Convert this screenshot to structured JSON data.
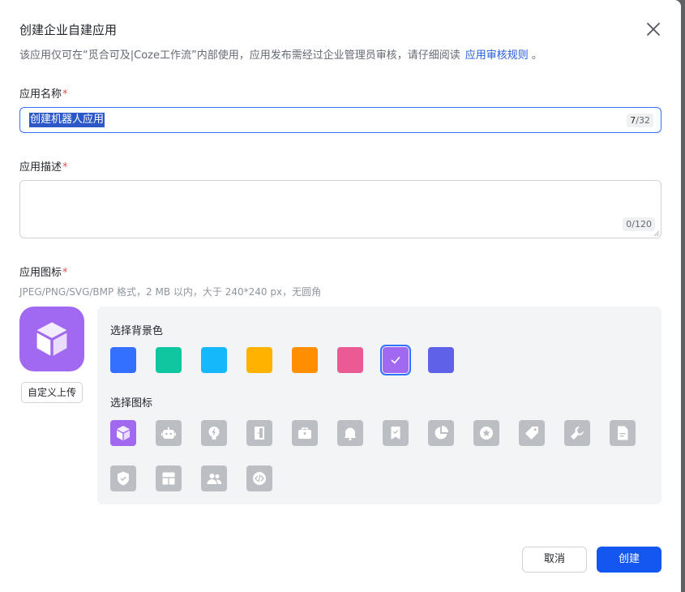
{
  "dialog": {
    "title": "创建企业自建应用",
    "subtitle": "该应用仅可在“觅合可及|Coze工作流”内部使用，应用发布需经过企业管理员审核，请仔细阅读",
    "rules_link": "应用审核规则",
    "subtitle_end": "。"
  },
  "name_field": {
    "label": "应用名称",
    "required_mark": "*",
    "value": "创建机器人应用",
    "count": "7",
    "max": "/32"
  },
  "desc_field": {
    "label": "应用描述",
    "required_mark": "*",
    "value": "",
    "counter": "0/120"
  },
  "icon_field": {
    "label": "应用图标",
    "required_mark": "*",
    "hint": "JPEG/PNG/SVG/BMP 格式，2 MB 以内，大于 240*240 px，无圆角",
    "upload_label": "自定义上传",
    "bg_title": "选择背景色",
    "icon_title": "选择图标",
    "colors": [
      "#3370ff",
      "#0fc6a0",
      "#15b8fa",
      "#ffb300",
      "#ff8f00",
      "#ea5a95",
      "#a169f0",
      "#5f62e8"
    ],
    "selected_color": "#a169f0",
    "icons": [
      "cube-icon",
      "robot-icon",
      "lightbulb-icon",
      "door-icon",
      "briefcase-icon",
      "bell-icon",
      "bookmark-check-icon",
      "pie-chart-icon",
      "star-badge-icon",
      "tag-icon",
      "wrench-icon",
      "document-icon",
      "shield-check-icon",
      "layout-icon",
      "users-icon",
      "code-icon"
    ],
    "selected_icon": "cube-icon"
  },
  "footer": {
    "cancel_label": "取消",
    "create_label": "创建"
  }
}
